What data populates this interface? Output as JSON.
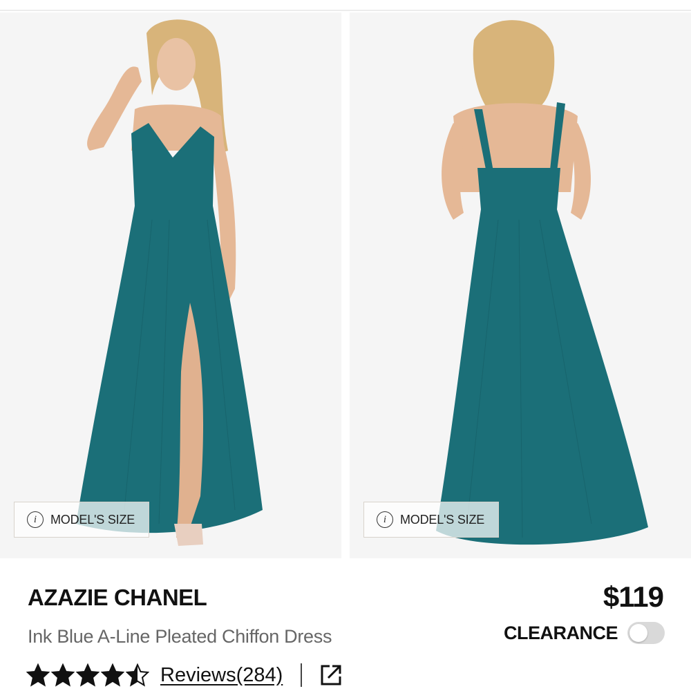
{
  "gallery": {
    "images": [
      {
        "name": "front",
        "model_size_label": "MODEL'S SIZE",
        "info_glyph": "i"
      },
      {
        "name": "back",
        "model_size_label": "MODEL'S SIZE",
        "info_glyph": "i"
      }
    ],
    "dress_color": "#1b6f78"
  },
  "product": {
    "brand": "AZAZIE CHANEL",
    "name": "Ink Blue A-Line Pleated Chiffon Dress",
    "price": "$119",
    "clearance_label": "CLEARANCE",
    "clearance_toggle_on": false,
    "rating": 4.5,
    "rating_max": 5,
    "reviews_label": "Reviews(284)"
  },
  "icons": [
    "info-icon",
    "star-icon",
    "half-star-icon",
    "share-icon"
  ]
}
